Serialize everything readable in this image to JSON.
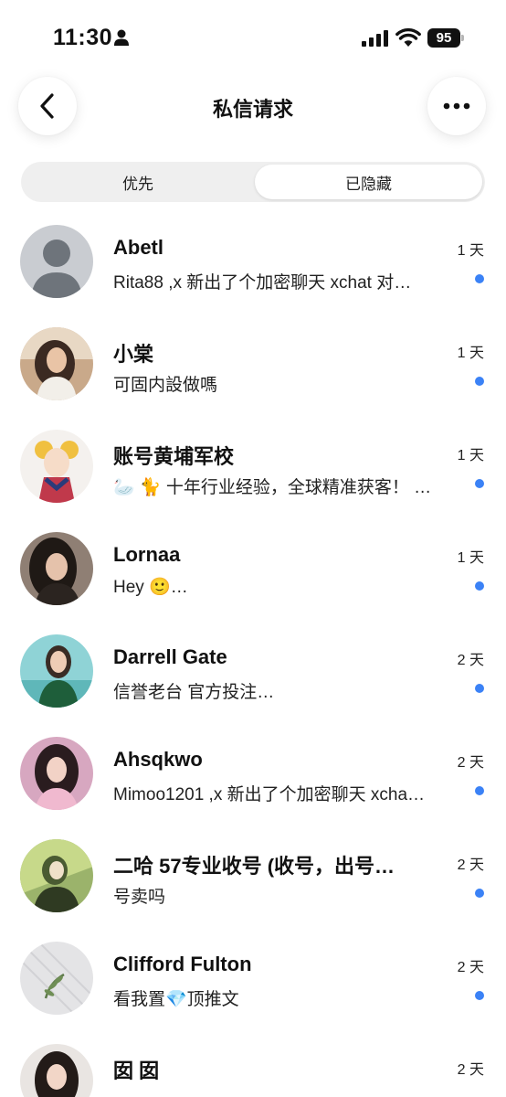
{
  "status_bar": {
    "time": "11:30",
    "battery": "95"
  },
  "header": {
    "title": "私信请求"
  },
  "tabs": [
    {
      "label": "优先",
      "selected": false
    },
    {
      "label": "已隐藏",
      "selected": true
    }
  ],
  "colors": {
    "accent": "#3b82f6",
    "segment_bg": "#efefef"
  },
  "conversations": [
    {
      "name": "Abetl",
      "preview": "Rita88 ,x 新出了个加密聊天 xchat 对…",
      "time": "1 天",
      "unread": true
    },
    {
      "name": "小棠",
      "preview": "可固内設做嗎",
      "time": "1 天",
      "unread": true
    },
    {
      "name": "账号黄埔军校",
      "preview": "🦢 🐈 十年行业经验，全球精准获客！ …",
      "time": "1 天",
      "unread": true
    },
    {
      "name": "Lornaa",
      "preview": "Hey 🙂…",
      "time": "1 天",
      "unread": true
    },
    {
      "name": "Darrell Gate",
      "preview": "信誉老台 官方投注…",
      "time": "2 天",
      "unread": true
    },
    {
      "name": "Ahsqkwo",
      "preview": "Mimoo1201 ,x 新出了个加密聊天 xcha…",
      "time": "2 天",
      "unread": true
    },
    {
      "name": "二哈 57专业收号 (收号，出号…",
      "preview": "号卖吗",
      "time": "2 天",
      "unread": true
    },
    {
      "name": "Clifford Fulton",
      "preview": "看我置💎顶推文",
      "time": "2 天",
      "unread": true
    },
    {
      "name": "囡 囡",
      "preview": "",
      "time": "2 天",
      "unread": false
    }
  ]
}
